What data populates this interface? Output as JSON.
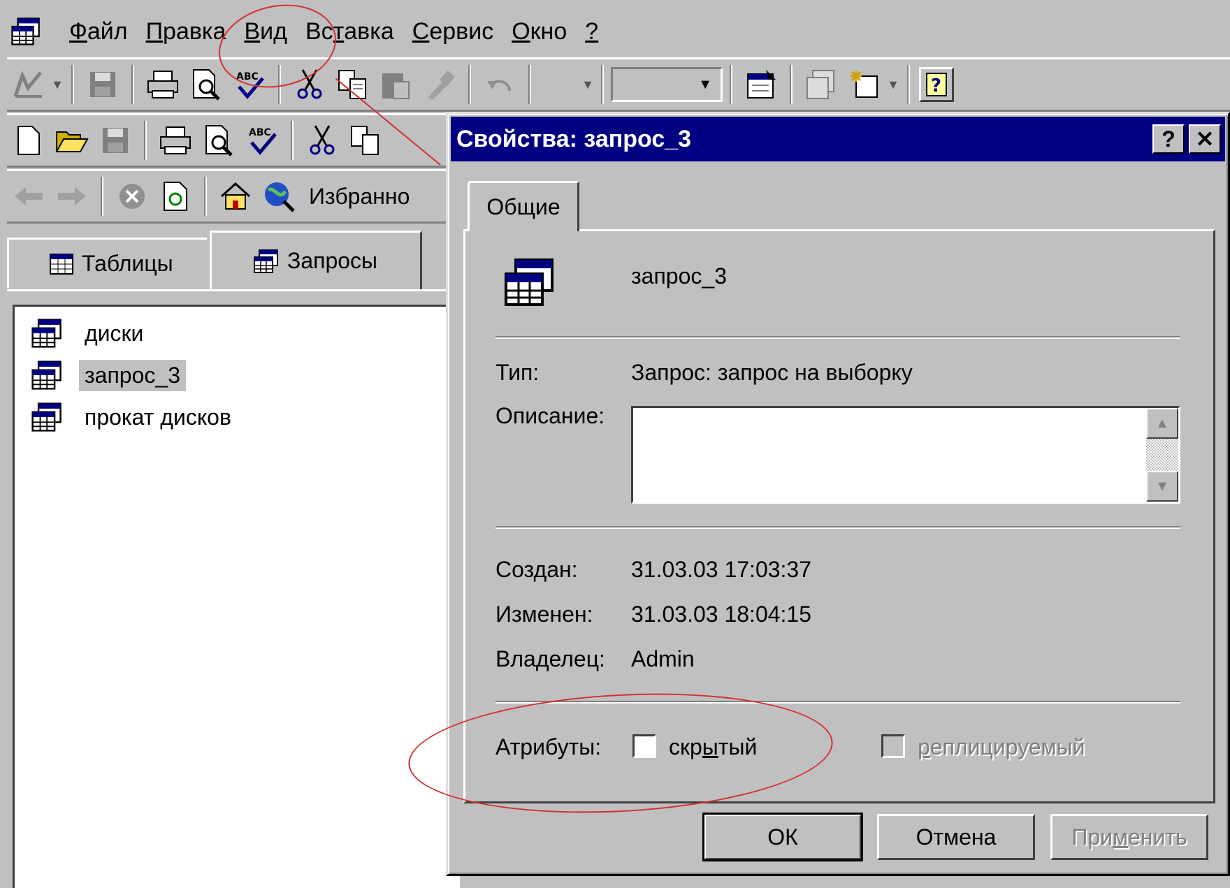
{
  "menu": {
    "items": [
      {
        "label": "Файл",
        "ul": "Ф",
        "rest": "айл"
      },
      {
        "label": "Правка",
        "ul": "П",
        "rest": "равка"
      },
      {
        "label": "Вид",
        "ul": "В",
        "rest": "ид"
      },
      {
        "label": "Вставка",
        "pre": "Вс",
        "ul": "т",
        "rest": "авка"
      },
      {
        "label": "Сервис",
        "ul": "С",
        "rest": "ервис"
      },
      {
        "label": "Окно",
        "ul": "О",
        "rest": "кно"
      },
      {
        "label": "?",
        "ul": "?",
        "rest": ""
      }
    ]
  },
  "web_toolbar": {
    "favorites_label": "Избранно"
  },
  "db_window": {
    "tabs": {
      "tables": "Таблицы",
      "queries": "Запросы"
    },
    "items": [
      "диски",
      "запрос_3",
      "прокат дисков"
    ],
    "selected_index": 1
  },
  "dialog": {
    "title": "Свойства: запрос_3",
    "help_button": "?",
    "close_button": "✕",
    "tab_general": "Общие",
    "object_name": "запрос_3",
    "type_label": "Тип:",
    "type_value": "Запрос: запрос на выборку",
    "description_label": "Описание:",
    "description_value": "",
    "created_label": "Создан:",
    "created_value": "31.03.03 17:03:37",
    "modified_label": "Изменен:",
    "modified_value": "31.03.03 18:04:15",
    "owner_label": "Владелец:",
    "owner_value": "Admin",
    "attributes_label": "Атрибуты:",
    "hidden": {
      "pre": "скр",
      "ul": "ы",
      "rest": "тый",
      "checked": false
    },
    "replicated": {
      "ul": "р",
      "rest": "еплицируемый",
      "checked": false,
      "disabled": true
    },
    "ok_label": "ОК",
    "cancel_label": "Отмена",
    "apply": {
      "pre": "При",
      "ul": "м",
      "rest": "енить",
      "disabled": true
    }
  },
  "colors": {
    "face": "#c0c0c0",
    "title_bar": "#000080",
    "annotation": "#d23030",
    "selection": "#c0c0c0"
  }
}
